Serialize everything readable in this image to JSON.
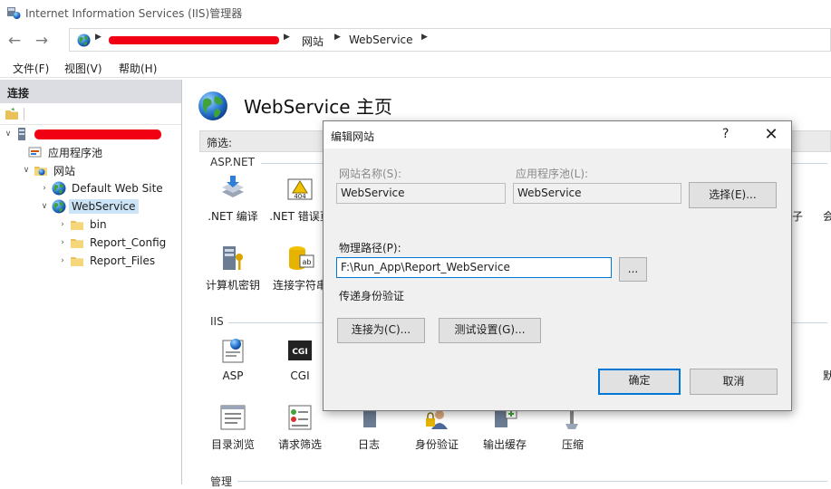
{
  "window": {
    "title": "Internet Information Services (IIS)管理器"
  },
  "address": {
    "segments": [
      "网站",
      "WebService"
    ]
  },
  "menu": {
    "file": "文件(F)",
    "view": "视图(V)",
    "help": "帮助(H)"
  },
  "connections": {
    "header": "连接",
    "tree": {
      "app_pools": "应用程序池",
      "sites": "网站",
      "default_site": "Default Web Site",
      "webservice": "WebService",
      "children": [
        "bin",
        "Report_Config",
        "Report_Files"
      ]
    }
  },
  "main": {
    "title": "WebService 主页",
    "filter_label": "筛选:",
    "groups": {
      "aspnet": "ASP.NET",
      "iis": "IIS",
      "management": "管理"
    },
    "features_aspnet": [
      {
        "label": ".NET 编译",
        "icon": "compile-icon"
      },
      {
        "label": ".NET 错误页",
        "icon": "error-page-icon"
      },
      {
        "label": "计算机密钥",
        "icon": "machine-key-icon"
      },
      {
        "label": "连接字符串",
        "icon": "connection-string-icon"
      }
    ],
    "features_iis": [
      {
        "label": "ASP",
        "icon": "asp-icon"
      },
      {
        "label": "CGI",
        "icon": "cgi-icon"
      },
      {
        "label": "目录浏览",
        "icon": "directory-browsing-icon"
      },
      {
        "label": "请求筛选",
        "icon": "request-filtering-icon"
      },
      {
        "label": "日志",
        "icon": "logging-icon"
      },
      {
        "label": "身份验证",
        "icon": "authentication-icon"
      },
      {
        "label": "输出缓存",
        "icon": "output-cache-icon"
      },
      {
        "label": "压缩",
        "icon": "compression-icon"
      }
    ],
    "partial_labels": [
      "子",
      "会",
      "默"
    ]
  },
  "dialog": {
    "title": "编辑网站",
    "help": "?",
    "site_name_label": "网站名称(S):",
    "site_name": "WebService",
    "app_pool_label": "应用程序池(L):",
    "app_pool": "WebService",
    "select_button": "选择(E)...",
    "physical_path_label": "物理路径(P):",
    "physical_path": "F:\\Run_App\\Report_WebService",
    "browse_button": "...",
    "pass_through_label": "传递身份验证",
    "connect_as_button": "连接为(C)...",
    "test_settings_button": "测试设置(G)...",
    "ok_button": "确定",
    "cancel_button": "取消"
  },
  "colors": {
    "accent": "#0078d7",
    "redaction": "#f00012",
    "selection": "#cce4f7",
    "panel_header": "#dbdde2"
  }
}
